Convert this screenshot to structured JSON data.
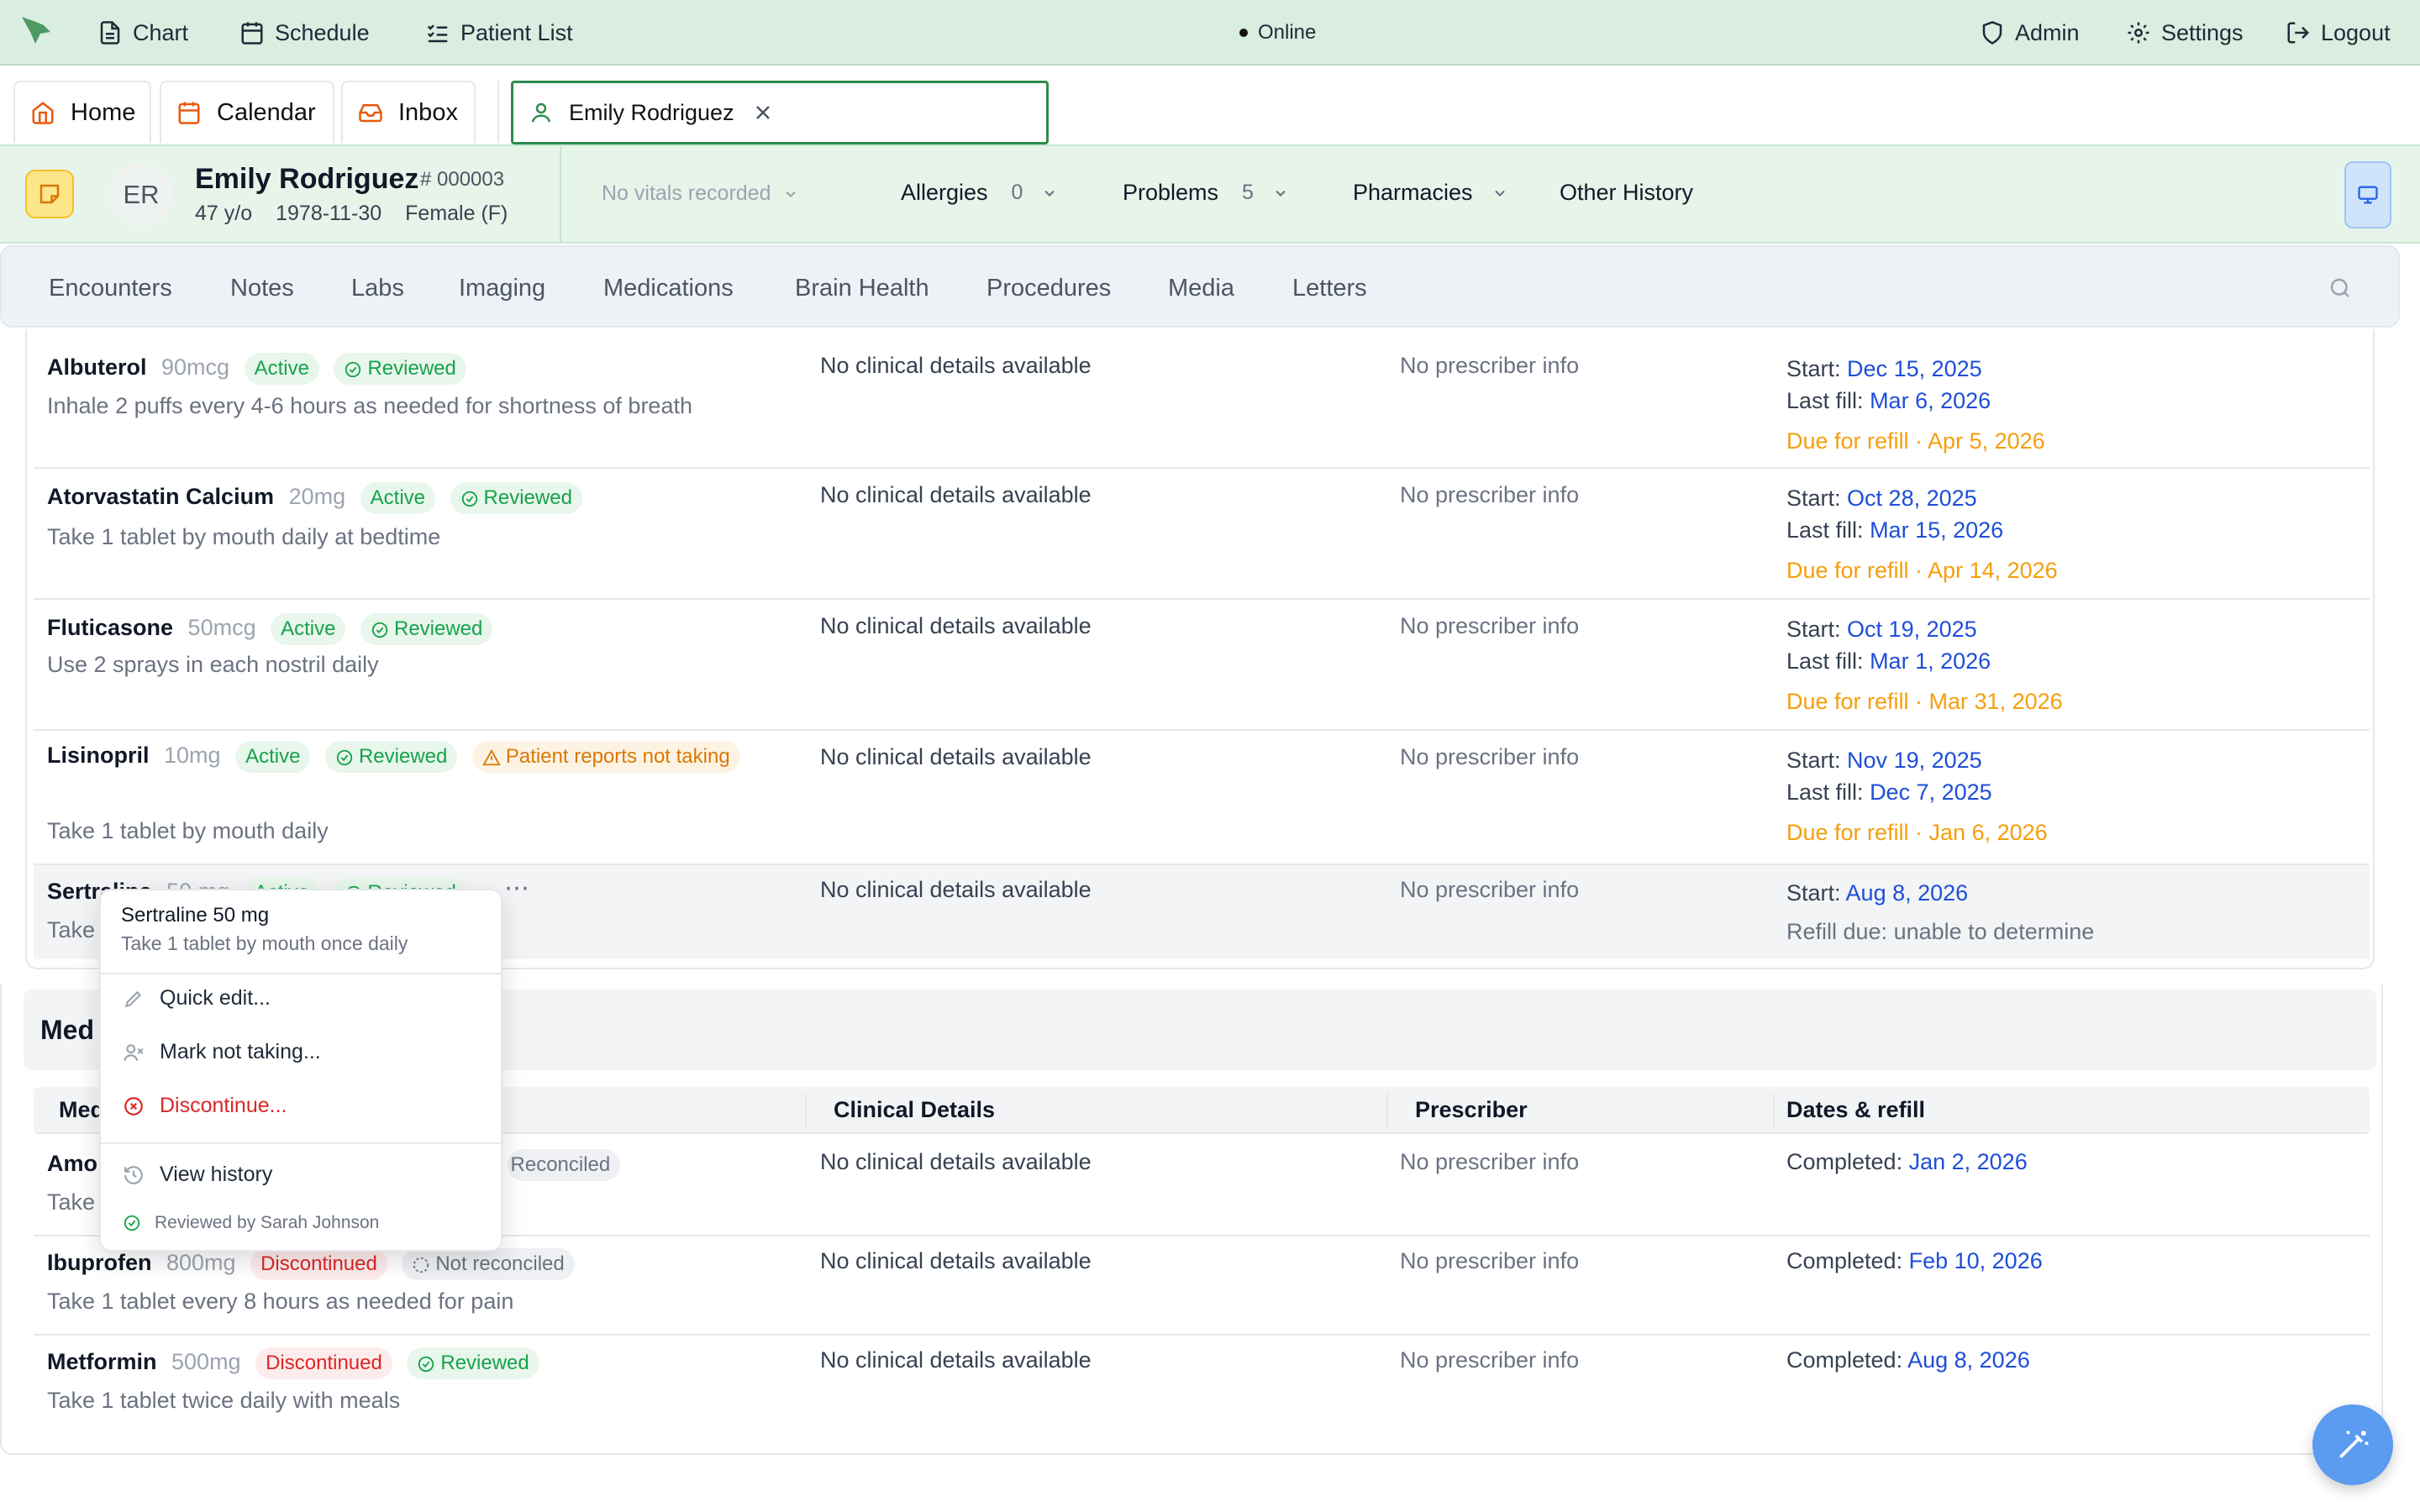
{
  "topnav": {
    "chart": "Chart",
    "schedule": "Schedule",
    "patient_list": "Patient List",
    "status": "Online",
    "admin": "Admin",
    "settings": "Settings",
    "logout": "Logout"
  },
  "tabs": {
    "home": "Home",
    "calendar": "Calendar",
    "inbox": "Inbox",
    "patient": "Emily Rodriguez"
  },
  "patient": {
    "initials": "ER",
    "name": "Emily Rodriguez",
    "id": "# 000003",
    "age": "47 y/o",
    "dob": "1978-11-30",
    "sex": "Female (F)",
    "vitals": "No vitals recorded",
    "allergies_label": "Allergies",
    "allergies_count": "0",
    "problems_label": "Problems",
    "problems_count": "5",
    "pharmacies_label": "Pharmacies",
    "other_history": "Other History"
  },
  "subnav": [
    "Encounters",
    "Notes",
    "Labs",
    "Imaging",
    "Medications",
    "Brain Health",
    "Procedures",
    "Media",
    "Letters"
  ],
  "active_meds": [
    {
      "name": "Albuterol",
      "dose": "90mcg",
      "status": "Active",
      "review": "Reviewed",
      "sig": "Inhale 2 puffs every 4-6 hours as needed for shortness of breath",
      "clinical": "No clinical details available",
      "prescriber": "No prescriber info",
      "start_label": "Start:",
      "start": "Dec 15, 2025",
      "fill_label": "Last fill:",
      "fill": "Mar 6, 2026",
      "refill": "Due for refill · Apr 5, 2026"
    },
    {
      "name": "Atorvastatin Calcium",
      "dose": "20mg",
      "status": "Active",
      "review": "Reviewed",
      "sig": "Take 1 tablet by mouth daily at bedtime",
      "clinical": "No clinical details available",
      "prescriber": "No prescriber info",
      "start_label": "Start:",
      "start": "Oct 28, 2025",
      "fill_label": "Last fill:",
      "fill": "Mar 15, 2026",
      "refill": "Due for refill · Apr 14, 2026"
    },
    {
      "name": "Fluticasone",
      "dose": "50mcg",
      "status": "Active",
      "review": "Reviewed",
      "sig": "Use 2 sprays in each nostril daily",
      "clinical": "No clinical details available",
      "prescriber": "No prescriber info",
      "start_label": "Start:",
      "start": "Oct 19, 2025",
      "fill_label": "Last fill:",
      "fill": "Mar 1, 2026",
      "refill": "Due for refill · Mar 31, 2026"
    },
    {
      "name": "Lisinopril",
      "dose": "10mg",
      "status": "Active",
      "review": "Reviewed",
      "warning": "Patient reports not taking",
      "sig": "Take 1 tablet by mouth daily",
      "clinical": "No clinical details available",
      "prescriber": "No prescriber info",
      "start_label": "Start:",
      "start": "Nov 19, 2025",
      "fill_label": "Last fill:",
      "fill": "Dec 7, 2025",
      "refill": "Due for refill · Jan 6, 2026"
    },
    {
      "name": "Sertraline",
      "dose": "50 mg",
      "status": "Active",
      "review": "Reviewed",
      "sig": "Take",
      "clinical": "No clinical details available",
      "prescriber": "No prescriber info",
      "start_label": "Start:",
      "start": "Aug 8, 2026",
      "refill": "Refill due: unable to determine"
    }
  ],
  "history_section": {
    "title": "Med",
    "columns": {
      "med": "Med",
      "clinical": "Clinical Details",
      "prescriber": "Prescriber",
      "dates": "Dates & refill"
    }
  },
  "history_meds": [
    {
      "name": "Amo",
      "review": "Reconciled",
      "sig": "Take",
      "clinical": "No clinical details available",
      "prescriber": "No prescriber info",
      "date_label": "Completed:",
      "date": "Jan 2, 2026"
    },
    {
      "name": "Ibuprofen",
      "dose": "800mg",
      "status": "Discontinued",
      "review": "Not reconciled",
      "sig": "Take 1 tablet every 8 hours as needed for pain",
      "clinical": "No clinical details available",
      "prescriber": "No prescriber info",
      "date_label": "Completed:",
      "date": "Feb 10, 2026"
    },
    {
      "name": "Metformin",
      "dose": "500mg",
      "status": "Discontinued",
      "review": "Reviewed",
      "sig": "Take 1 tablet twice daily with meals",
      "clinical": "No clinical details available",
      "prescriber": "No prescriber info",
      "date_label": "Completed:",
      "date": "Aug 8, 2026"
    }
  ],
  "popup": {
    "title": "Sertraline 50 mg",
    "subtitle": "Take 1 tablet by mouth once daily",
    "quick_edit": "Quick edit...",
    "mark_not_taking": "Mark not taking...",
    "discontinue": "Discontinue...",
    "view_history": "View history",
    "reviewed_by": "Reviewed by Sarah Johnson"
  },
  "colors": {
    "header_bg": "#d9ede0",
    "accent": "#2e8b4e",
    "link": "#1d4ed8",
    "refill": "#f59e0b",
    "danger": "#dc2626"
  }
}
